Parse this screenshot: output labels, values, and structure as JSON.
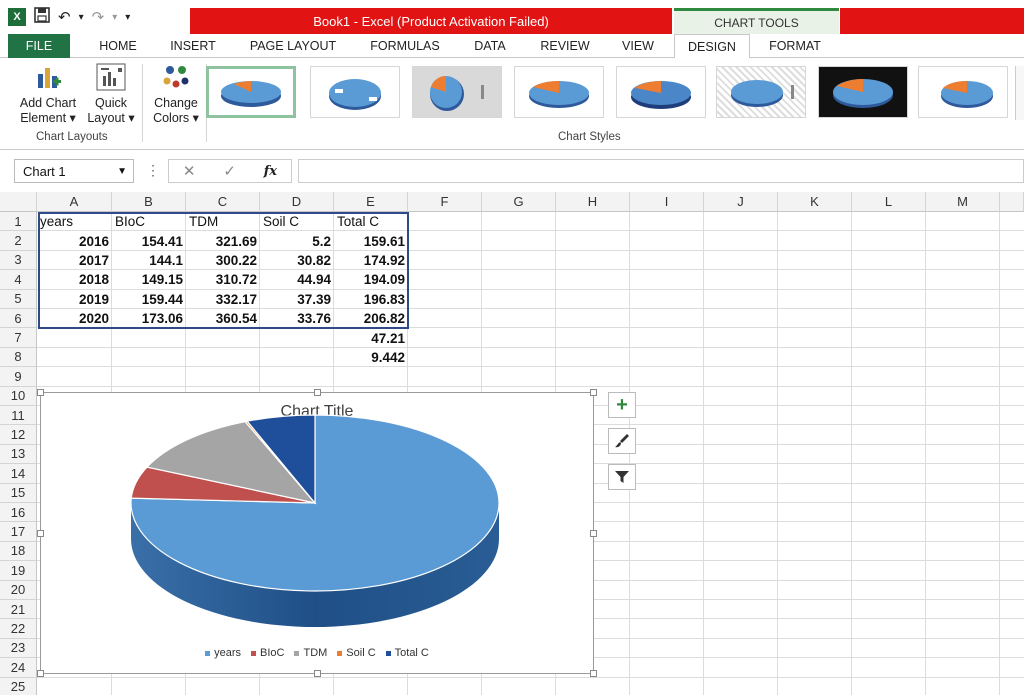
{
  "window": {
    "title": "Book1 -  Excel (Product Activation Failed)",
    "contextual_tab_group": "CHART TOOLS",
    "accent_red": "#e21313",
    "excel_green": "#217346"
  },
  "quick_access": {
    "app_icon_text": "X",
    "save_icon": "save-icon",
    "undo_glyph": "↶",
    "redo_glyph": "↷",
    "dropdown_glyph": "▾"
  },
  "tabs": [
    {
      "label": "FILE"
    },
    {
      "label": "HOME"
    },
    {
      "label": "INSERT"
    },
    {
      "label": "PAGE LAYOUT"
    },
    {
      "label": "FORMULAS"
    },
    {
      "label": "DATA"
    },
    {
      "label": "REVIEW"
    },
    {
      "label": "VIEW"
    },
    {
      "label": "DESIGN"
    },
    {
      "label": "FORMAT"
    }
  ],
  "ribbon": {
    "add_chart_element": {
      "line1": "Add Chart",
      "line2": "Element ▾"
    },
    "quick_layout": {
      "line1": "Quick",
      "line2": "Layout ▾"
    },
    "change_colors": {
      "line1": "Change",
      "line2": "Colors ▾"
    },
    "group_chart_layouts": "Chart Layouts",
    "group_chart_styles": "Chart Styles",
    "style_count": 8
  },
  "formula_bar": {
    "name_box": "Chart 1",
    "name_box_dropdown": "▼",
    "vertical_dots": "⋮",
    "cancel_glyph": "✕",
    "enter_glyph": "✓",
    "fx_label": "fx",
    "formula_value": ""
  },
  "columns": [
    "A",
    "B",
    "C",
    "D",
    "E",
    "F",
    "G",
    "H",
    "I",
    "J",
    "K",
    "L",
    "M"
  ],
  "rows": [
    "1",
    "2",
    "3",
    "4",
    "5",
    "6",
    "7",
    "8",
    "9",
    "10",
    "11",
    "12",
    "13",
    "14",
    "15",
    "16",
    "17",
    "18",
    "19",
    "20",
    "21",
    "22",
    "23",
    "24",
    "25"
  ],
  "sheet": {
    "headers": [
      "years",
      "BIoC",
      "TDM",
      "Soil C",
      "Total C"
    ],
    "data": [
      [
        "2016",
        "154.41",
        "321.69",
        "5.2",
        "159.61"
      ],
      [
        "2017",
        "144.1",
        "300.22",
        "30.82",
        "174.92"
      ],
      [
        "2018",
        "149.15",
        "310.72",
        "44.94",
        "194.09"
      ],
      [
        "2019",
        "159.44",
        "332.17",
        "37.39",
        "196.83"
      ],
      [
        "2020",
        "173.06",
        "360.54",
        "33.76",
        "206.82"
      ]
    ],
    "e7": "47.21",
    "e8": "9.442"
  },
  "chart_data": {
    "type": "pie",
    "title": "Chart Title",
    "categories": [
      "years",
      "BIoC",
      "TDM",
      "Soil C",
      "Total C"
    ],
    "values": [
      2016,
      154.41,
      321.69,
      5.2,
      159.61
    ],
    "colors": [
      "#5b9bd5",
      "#c0504d",
      "#a5a5a5",
      "#ed7d31",
      "#1f4e9a"
    ],
    "legend_position": "bottom",
    "style": "3-D pie"
  },
  "chart_side_buttons": [
    {
      "name": "chart-elements",
      "glyph": "+"
    },
    {
      "name": "chart-styles",
      "glyph": "brush"
    },
    {
      "name": "chart-filters",
      "glyph": "filter"
    }
  ]
}
